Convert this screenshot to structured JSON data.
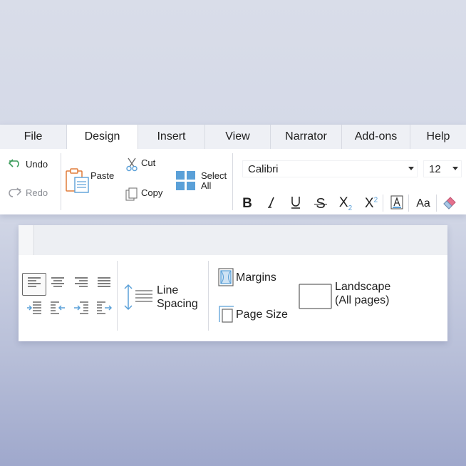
{
  "ribbon_top": {
    "tabs": [
      {
        "label": "File"
      },
      {
        "label": "Design",
        "active": true
      },
      {
        "label": "Insert"
      },
      {
        "label": "View"
      },
      {
        "label": "Narrator"
      },
      {
        "label": "Add-ons"
      },
      {
        "label": "Help"
      }
    ],
    "history": {
      "undo_label": "Undo",
      "redo_label": "Redo"
    },
    "clipboard": {
      "paste_label": "Paste",
      "cut_label": "Cut",
      "copy_label": "Copy",
      "select_all_line1": "Select",
      "select_all_line2": "All"
    },
    "font": {
      "family": "Calibri",
      "size": "12",
      "subscript_mark": "2",
      "superscript_mark": "2",
      "case_label": "Aa"
    }
  },
  "ribbon_layout": {
    "line_spacing_line1": "Line",
    "line_spacing_line2": "Spacing",
    "margins_label": "Margins",
    "page_size_label": "Page Size",
    "orientation_line1": "Landscape",
    "orientation_line2": "(All pages)"
  },
  "colors": {
    "accent_blue": "#5aa0d8",
    "paste_orange": "#e07b39",
    "undo_green": "#3a9b5a",
    "eraser_pink": "#e4708c"
  },
  "icons": [
    "undo-icon",
    "redo-icon",
    "paste-icon",
    "cut-icon",
    "copy-icon",
    "select-all-icon",
    "bold-icon",
    "italic-icon",
    "underline-icon",
    "strikethrough-icon",
    "subscript-icon",
    "superscript-icon",
    "text-highlight-icon",
    "change-case-icon",
    "clear-format-icon",
    "line-spacing-icon",
    "margins-icon",
    "page-size-icon",
    "orientation-icon"
  ]
}
